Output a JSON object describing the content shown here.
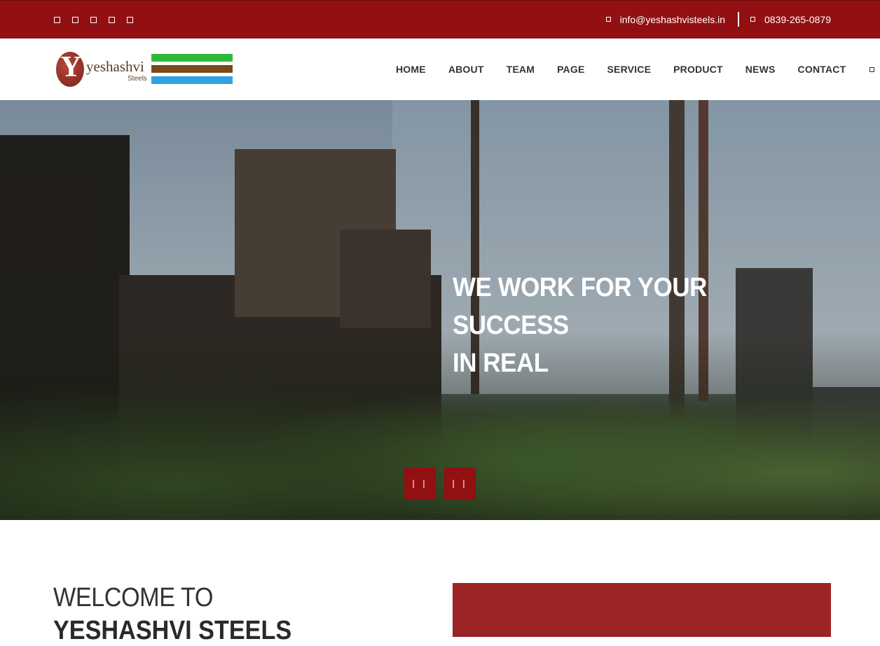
{
  "topbar": {
    "social_icons": [
      "facebook-icon",
      "twitter-icon",
      "google-plus-icon",
      "linkedin-icon",
      "instagram-icon"
    ],
    "email": "info@yeshashvisteels.in",
    "phone": "0839-265-0879"
  },
  "logo": {
    "initial": "Y",
    "name": "yeshashvi",
    "subtitle": "Steels",
    "stripe_colors": [
      "#2eb83a",
      "#7a4a1c",
      "#2ea3e0"
    ]
  },
  "nav": {
    "items": [
      "HOME",
      "ABOUT",
      "TEAM",
      "PAGE",
      "SERVICE",
      "PRODUCT",
      "NEWS",
      "CONTACT"
    ],
    "search_icon": "search-icon"
  },
  "hero": {
    "headline_line1": "WE WORK FOR YOUR SUCCESS",
    "headline_line2": "IN REAL",
    "prev_label": "| |",
    "next_label": "| |"
  },
  "welcome": {
    "line1": "WELCOME TO",
    "line2": "YESHASHVI STEELS"
  },
  "colors": {
    "brand_red": "#920f12"
  }
}
